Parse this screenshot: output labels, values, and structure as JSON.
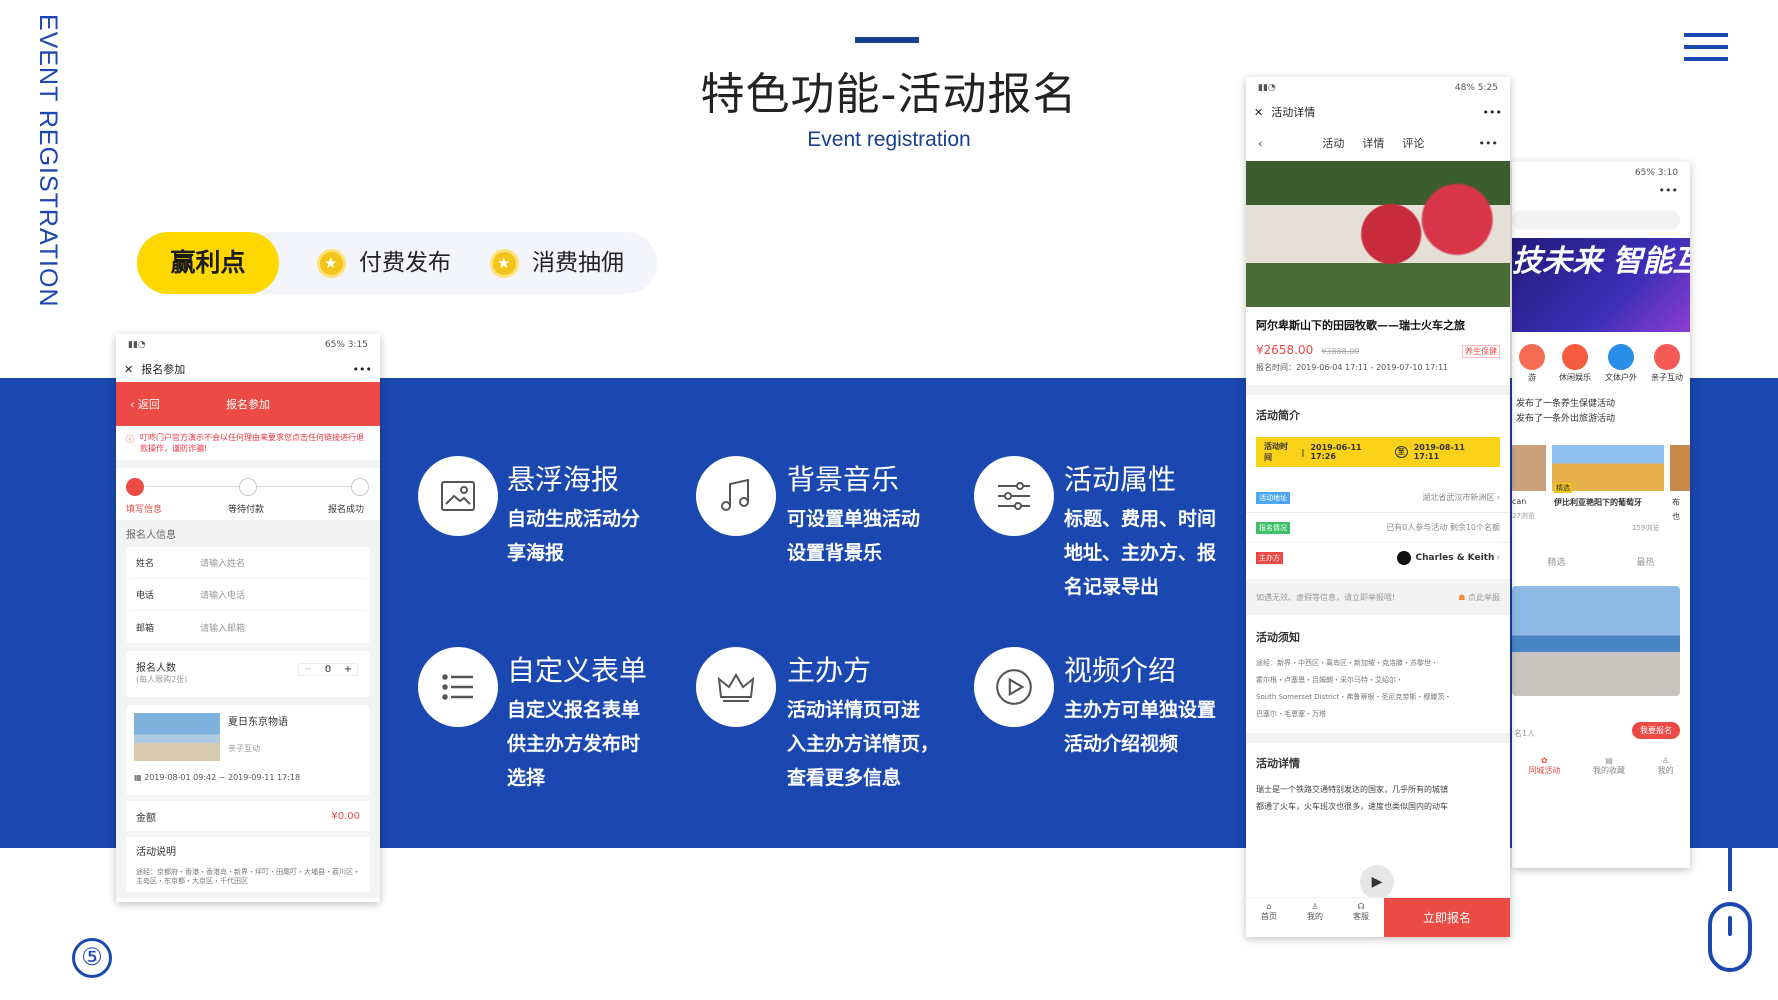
{
  "side_label": "EVENT REGISTRATION",
  "title": "特色功能-活动报名",
  "subtitle": "Event registration",
  "pill": {
    "highlight": "赢利点",
    "items": [
      "付费发布",
      "消费抽佣"
    ]
  },
  "features": [
    {
      "icon": "image-icon",
      "title": "悬浮海报",
      "desc": [
        "自动生成活动分",
        "享海报"
      ]
    },
    {
      "icon": "music-note-icon",
      "title": "背景音乐",
      "desc": [
        "可设置单独活动",
        "设置背景乐"
      ]
    },
    {
      "icon": "sliders-icon",
      "title": "活动属性",
      "desc": [
        "标题、费用、时间",
        "地址、主办方、报",
        "名记录导出"
      ]
    },
    {
      "icon": "list-icon",
      "title": "自定义表单",
      "desc": [
        "自定义报名表单",
        "供主办方发布时",
        "选择"
      ]
    },
    {
      "icon": "crown-icon",
      "title": "主办方",
      "desc": [
        "活动详情页可进",
        "入主办方详情页，",
        "查看更多信息"
      ]
    },
    {
      "icon": "play-circle-icon",
      "title": "视频介绍",
      "desc": [
        "主办方可单独设置",
        "活动介绍视频"
      ]
    }
  ],
  "page_number": "⑤",
  "phone_left": {
    "status": "65% 3:15",
    "top_title": "报名参加",
    "red_header": {
      "back": "返回",
      "title": "报名参加"
    },
    "notice": "叮咚门户官方演示不会以任何理由来要求您点击任何链接进行退款操作，谨防诈骗!",
    "steps": [
      "填写信息",
      "等待付款",
      "报名成功"
    ],
    "section_info": "报名人信息",
    "fields": [
      {
        "label": "姓名",
        "placeholder": "请输入姓名"
      },
      {
        "label": "电话",
        "placeholder": "请输入电话"
      },
      {
        "label": "邮箱",
        "placeholder": "请输入邮箱"
      }
    ],
    "count_label": "报名人数",
    "count_sub": "(每人限购2张)",
    "count_value": "0",
    "event_name": "夏日东京物语",
    "event_tag": "亲子互动",
    "event_time": "2019-08-01 09:42 ~ 2019-09-11 17:18",
    "amount_label": "金额",
    "amount_value": "¥0.00",
    "desc_label": "活动说明",
    "desc_text": "途经：京都府・香港・香港岛・新界・坪叮・田尾叮・大埔县・荔川区・主岛区・东京都・大京区・千代田区"
  },
  "phone_mid": {
    "status": "48% 5:25",
    "top_title": "活动详情",
    "tabs": [
      "活动",
      "详情",
      "评论"
    ],
    "event_title": "阿尔卑斯山下的田园牧歌——瑞士火车之旅",
    "price": "¥2658.00",
    "orig_price": "¥3888.00",
    "tag": "养生保健",
    "time": "报名时间：2019-06-04 17:11 - 2019-07-10 17:11",
    "intro_label": "活动简介",
    "period_label": "活动时间",
    "period_start": "2019-06-11 17:26",
    "period_mid": "至",
    "period_end": "2019-08-11 17:11",
    "rows": [
      {
        "tag": "活动地址",
        "value": "湖北省武汉市新洲区"
      },
      {
        "tag": "报名情况",
        "value": "已有0人参与活动 剩余10个名额"
      },
      {
        "tag": "主办方",
        "value": "Charles & Keith"
      }
    ],
    "warn": "如遇无效、虚假等信息，请立即举报哦!",
    "report": "点此举报",
    "notice_label": "活动须知",
    "notice_text": [
      "途经：新界・中西区・离岛区・新加坡・克洛滕・苏黎世・",
      "霍尔根・卢塞恩・吕姆朗・采尔马特・艾绍尔・",
      "South Somerset District・弗鲁蒂根・圣尼克劳斯・穆滕茨・",
      "巴塞尔・毛恩塞・万塔"
    ],
    "detail_label": "活动详情",
    "detail_text": [
      "瑞士是一个铁路交通特别发达的国家，几乎所有的城镇",
      "都通了火车，火车班次也很多，速度也类似国内的动车"
    ],
    "nav": [
      "首页",
      "我的",
      "客服"
    ],
    "signup": "立即报名"
  },
  "phone_right": {
    "status": "65% 3:10",
    "banner": "技未来 智能互联",
    "icons": [
      "游",
      "休闲娱乐",
      "文体户外",
      "亲子互动"
    ],
    "news": [
      "发布了一条养生保健活动",
      "发布了一条外出旅游活动"
    ],
    "card_tag": "精选",
    "card_title": "伊比利亚艳阳下的葡萄牙",
    "card_views": "159浏览",
    "small_views": "27浏览",
    "cut_title": "can",
    "right_cut": [
      "布",
      "也"
    ],
    "filters": [
      "精选",
      "最热"
    ],
    "signup_small": "我要报名",
    "count": "名1人",
    "nav": [
      "同城活动",
      "我的收藏",
      "我的"
    ]
  }
}
